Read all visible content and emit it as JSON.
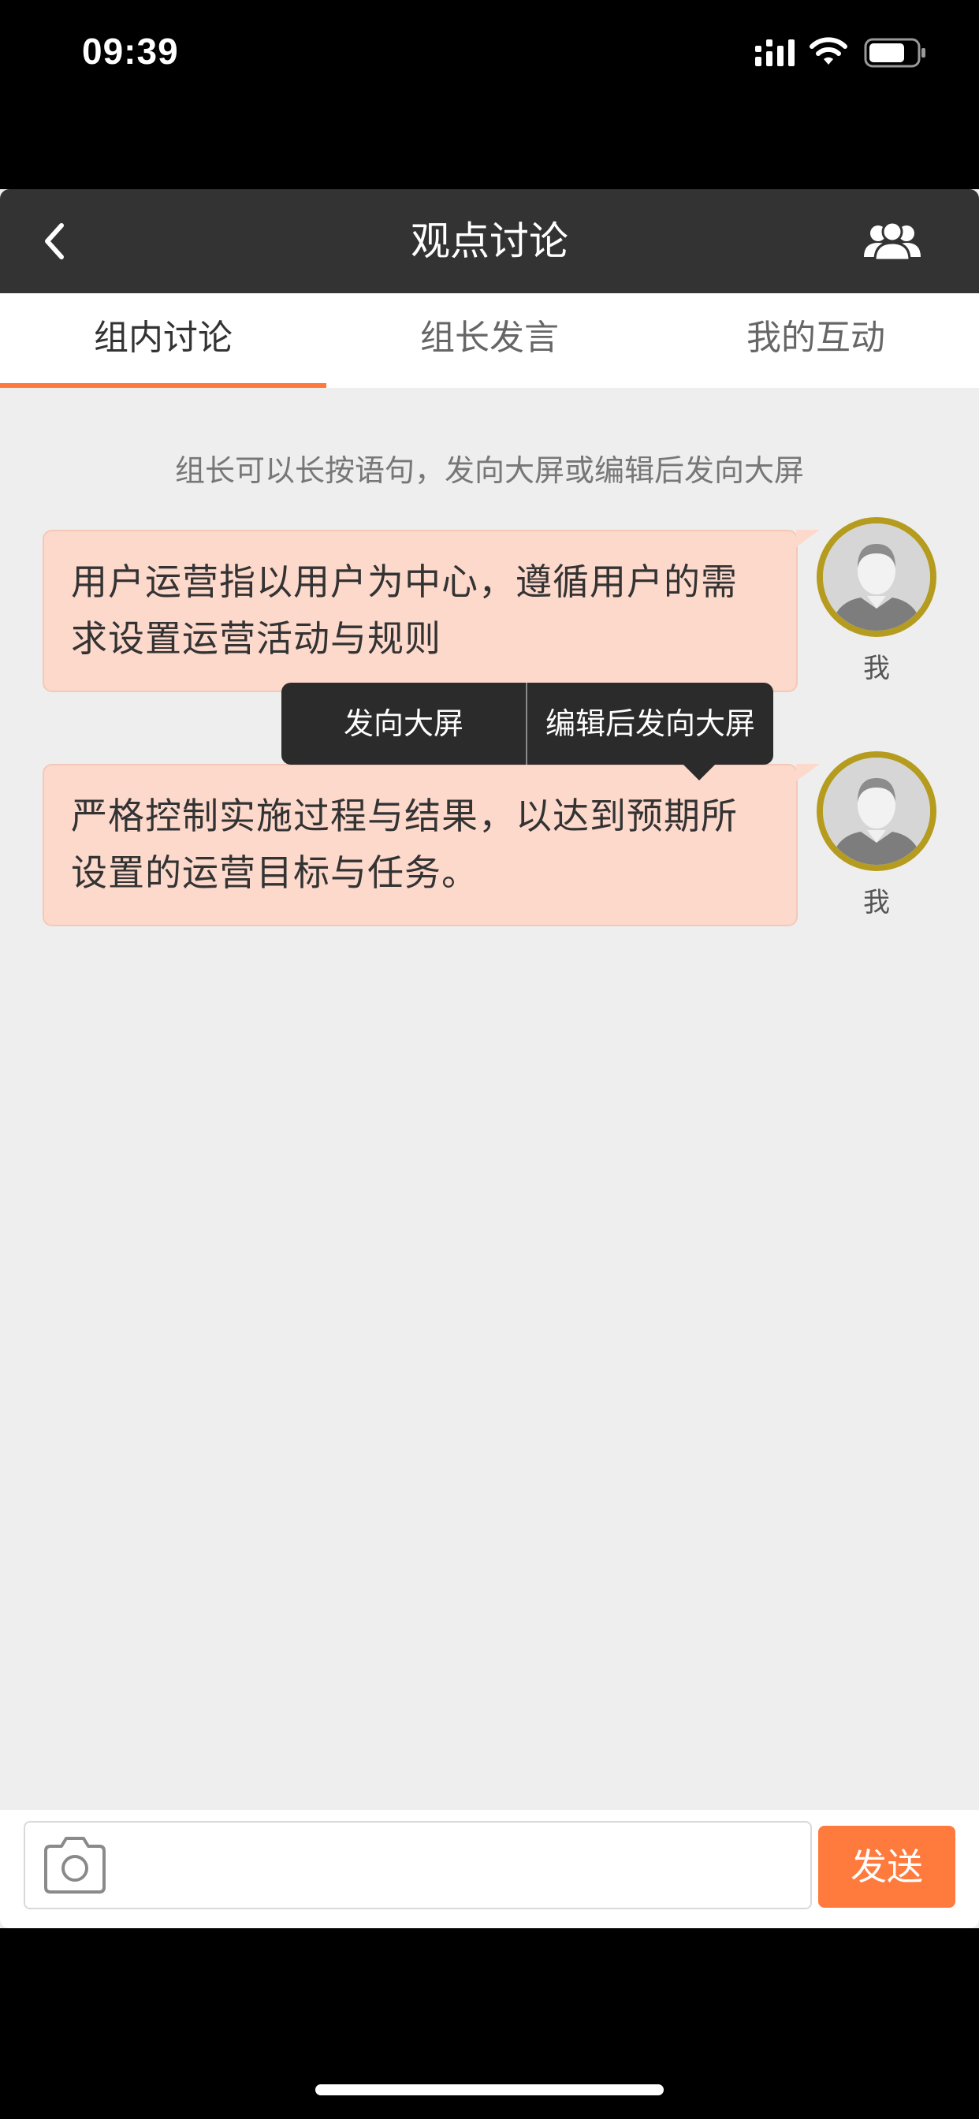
{
  "status_bar": {
    "time": "09:39"
  },
  "nav": {
    "title": "观点讨论"
  },
  "tabs": [
    {
      "label": "组内讨论",
      "active": true
    },
    {
      "label": "组长发言",
      "active": false
    },
    {
      "label": "我的互动",
      "active": false
    }
  ],
  "hint": "组长可以长按语句，发向大屏或编辑后发向大屏",
  "messages": [
    {
      "line1": "用户运营指以用户为中心，遵循用户的需",
      "line2": "求设置运营活动与规则",
      "author": "我"
    },
    {
      "line1": "严格控制实施过程与结果，以达到预期所",
      "line2": "设置的运营目标与任务。",
      "author": "我"
    }
  ],
  "popup_menu": {
    "items": [
      "发向大屏",
      "编辑后发向大屏"
    ]
  },
  "input": {
    "value": "",
    "placeholder": "",
    "send_label": "发送"
  },
  "colors": {
    "accent": "#ff7a3d",
    "nav_background": "#333333",
    "bubble_background": "#fdd9cc",
    "avatar_ring": "#b59b1e",
    "page_background": "#eeeeee"
  },
  "icons": [
    "back-chevron-icon",
    "group-members-icon",
    "camera-icon",
    "cellular-signal-icon",
    "wifi-icon",
    "battery-icon"
  ]
}
